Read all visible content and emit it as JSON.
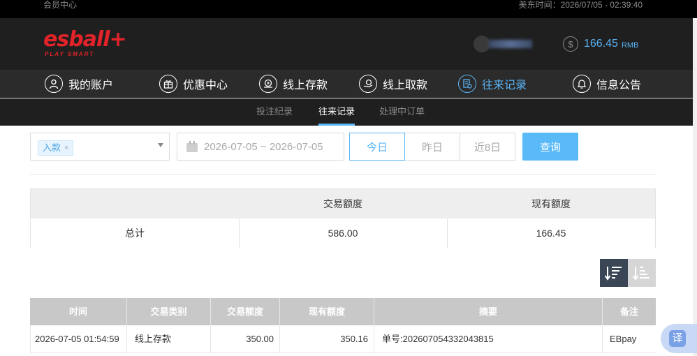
{
  "topbar": {
    "left": "会员中心",
    "right": "美东时间：2026/07/05 - 02:39:40"
  },
  "header": {
    "logo": "esball+",
    "logo_sub": "PLAY SMART",
    "balance": "166.45",
    "currency": "RMB"
  },
  "nav": {
    "items": [
      {
        "label": "我的账户",
        "icon": "user-icon"
      },
      {
        "label": "优惠中心",
        "icon": "gift-icon"
      },
      {
        "label": "线上存款",
        "icon": "deposit-icon"
      },
      {
        "label": "线上取款",
        "icon": "withdraw-icon"
      },
      {
        "label": "往来记录",
        "icon": "records-icon"
      },
      {
        "label": "信息公告",
        "icon": "bell-icon"
      }
    ],
    "active": "往来记录"
  },
  "subnav": {
    "items": [
      "投注纪录",
      "往来记录",
      "处理中订单"
    ],
    "active": "往来记录"
  },
  "filters": {
    "type_tag": "入款",
    "date_range": "2026-07-05 ~ 2026-07-05",
    "quick": [
      "今日",
      "昨日",
      "近8日"
    ],
    "active_quick": "今日",
    "query_label": "查询"
  },
  "summary": {
    "headers": [
      "",
      "交易额度",
      "现有额度"
    ],
    "row": [
      "总计",
      "586.00",
      "166.45"
    ]
  },
  "records": {
    "headers": [
      "时间",
      "交易类别",
      "交易额度",
      "现有额度",
      "摘要",
      "备注"
    ],
    "rows": [
      [
        "2026-07-05 01:54:59",
        "线上存款",
        "350.00",
        "350.16",
        "单号:202607054332043815",
        "EBpay"
      ]
    ]
  },
  "translate": {
    "label": "译"
  },
  "colors": {
    "accent": "#5ab4f5",
    "brand": "#e2232a",
    "header": "#1f1f1f"
  }
}
